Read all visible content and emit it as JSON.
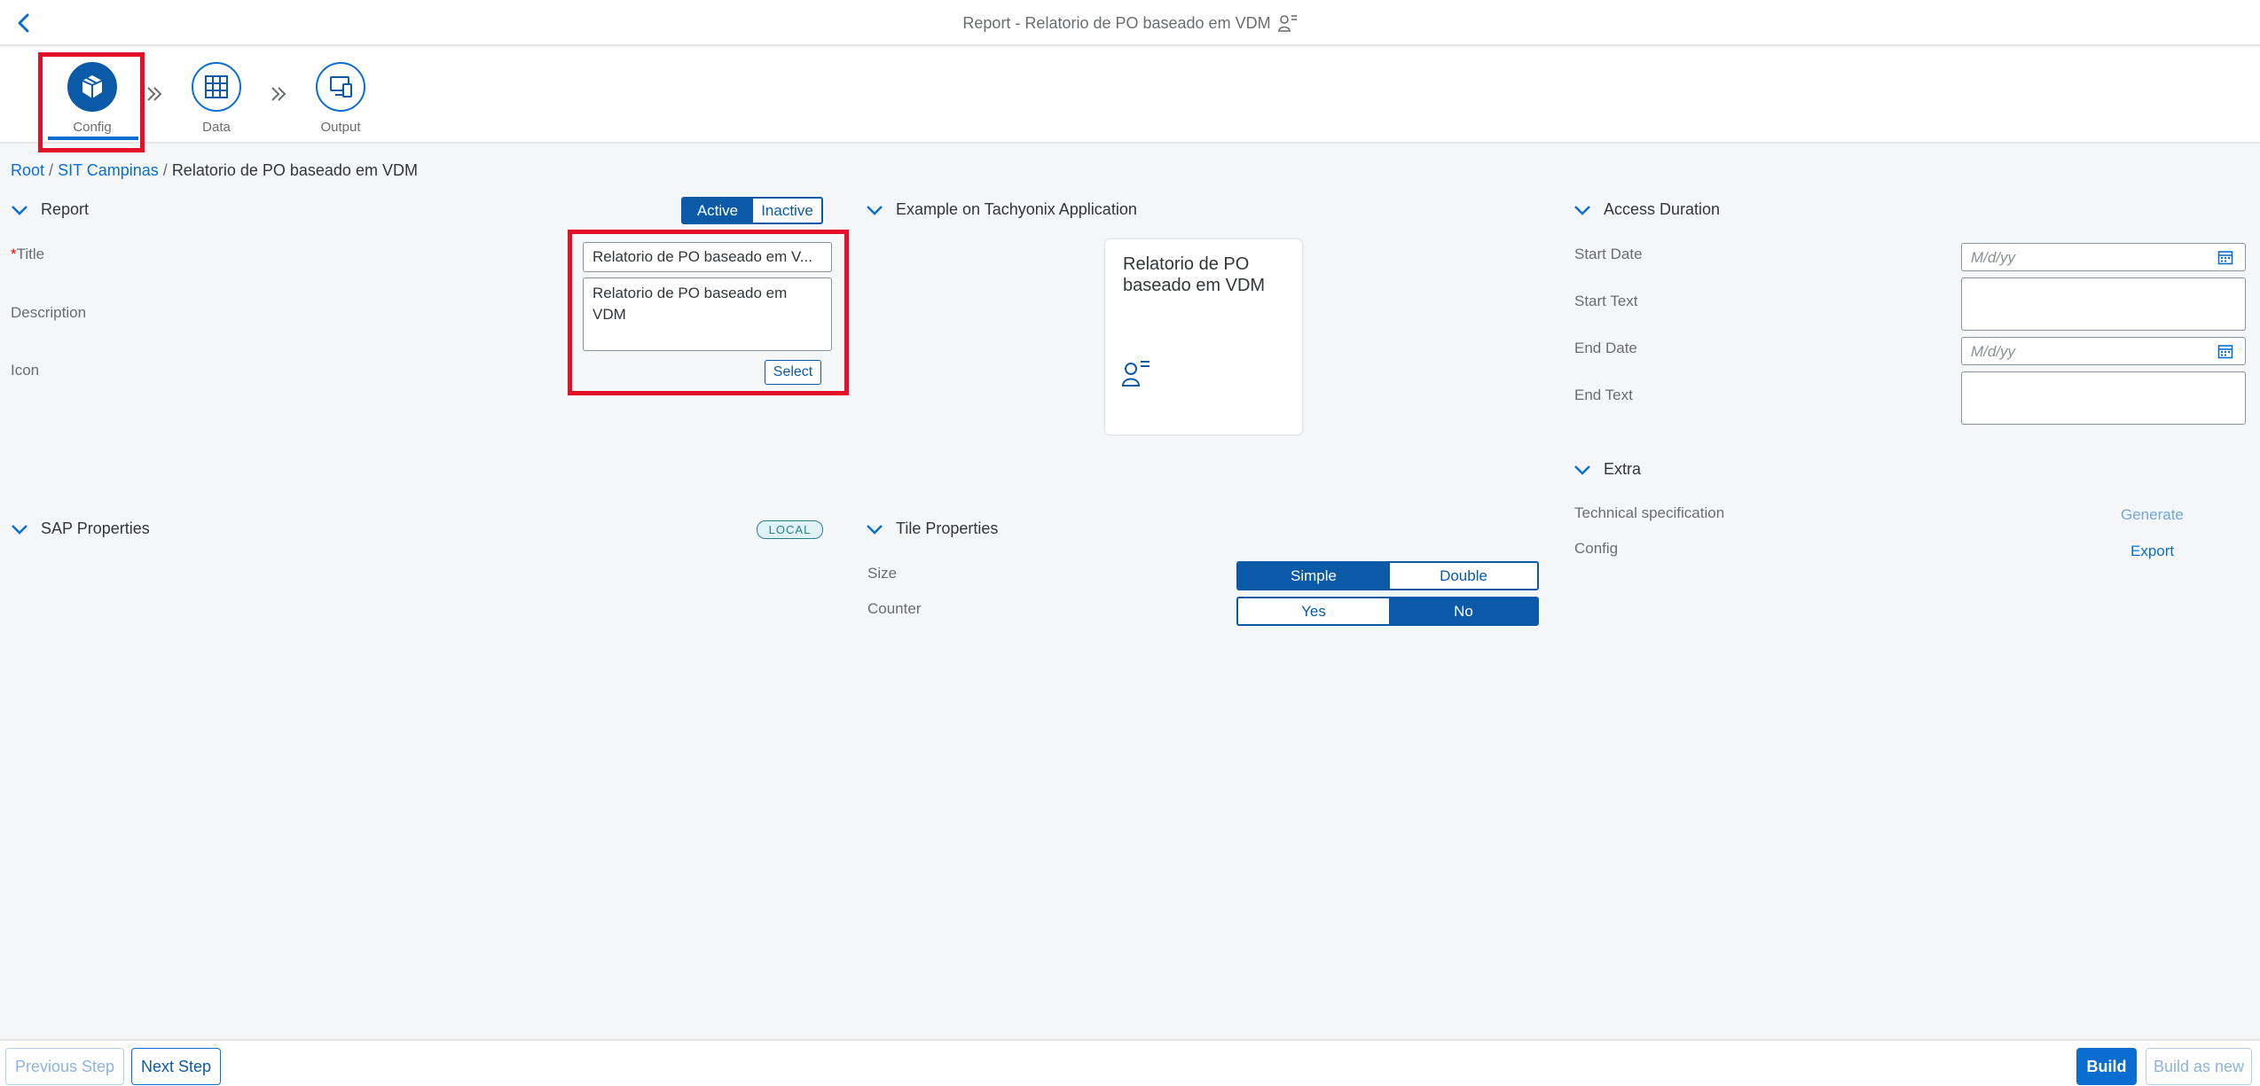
{
  "header": {
    "title": "Report - Relatorio de PO baseado em VDM"
  },
  "wizard": {
    "steps": [
      {
        "label": "Config"
      },
      {
        "label": "Data"
      },
      {
        "label": "Output"
      }
    ]
  },
  "breadcrumb": {
    "root": "Root",
    "parent": "SIT Campinas",
    "current": "Relatorio de PO baseado em VDM"
  },
  "report": {
    "section_title": "Report",
    "status": {
      "active": "Active",
      "inactive": "Inactive",
      "selected": "Active"
    },
    "title_label": "Title",
    "title_required": "*",
    "title_value": "Relatorio de PO baseado em V...",
    "description_label": "Description",
    "description_line1": "Relatorio de PO baseado em",
    "description_line2": "VDM",
    "icon_label": "Icon",
    "select_label": "Select"
  },
  "sap_properties": {
    "section_title": "SAP Properties",
    "badge": "LOCAL"
  },
  "example": {
    "section_title": "Example on Tachyonix Application",
    "tile_title": "Relatorio de PO baseado em VDM"
  },
  "tile_properties": {
    "section_title": "Tile Properties",
    "size_label": "Size",
    "size_options": {
      "simple": "Simple",
      "double": "Double"
    },
    "size_selected": "Simple",
    "counter_label": "Counter",
    "counter_options": {
      "yes": "Yes",
      "no": "No"
    },
    "counter_selected": "No"
  },
  "access_duration": {
    "section_title": "Access Duration",
    "start_date_label": "Start Date",
    "start_date_placeholder": "M/d/yy",
    "start_text_label": "Start Text",
    "end_date_label": "End Date",
    "end_date_placeholder": "M/d/yy",
    "end_text_label": "End Text"
  },
  "extra": {
    "section_title": "Extra",
    "tech_spec_label": "Technical specification",
    "generate_label": "Generate",
    "config_label": "Config",
    "export_label": "Export"
  },
  "footer": {
    "previous": "Previous Step",
    "next": "Next Step",
    "build": "Build",
    "build_new": "Build as new"
  },
  "colors": {
    "accent": "#0a6ed1",
    "accent_dark": "#0a5aa8",
    "highlight": "#e30f26"
  }
}
